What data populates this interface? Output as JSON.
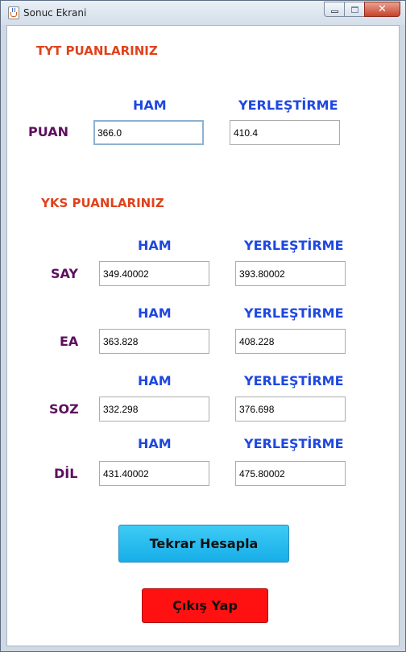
{
  "window": {
    "title": "Sonuc Ekrani",
    "close_glyph": "✕"
  },
  "tyt": {
    "title": "TYT PUANLARINIZ",
    "ham_header": "HAM",
    "yerlestirme_header": "YERLEŞTİRME",
    "row_label": "PUAN",
    "ham_value": "366.0",
    "yerlestirme_value": "410.4"
  },
  "yks": {
    "title": "YKS PUANLARINIZ",
    "rows": [
      {
        "label": "SAY",
        "ham_header": "HAM",
        "yerlestirme_header": "YERLEŞTİRME",
        "ham_value": "349.40002",
        "yerlestirme_value": "393.80002"
      },
      {
        "label": "EA",
        "ham_header": "HAM",
        "yerlestirme_header": "YERLEŞTİRME",
        "ham_value": "363.828",
        "yerlestirme_value": "408.228"
      },
      {
        "label": "SOZ",
        "ham_header": "HAM",
        "yerlestirme_header": "YERLEŞTİRME",
        "ham_value": "332.298",
        "yerlestirme_value": "376.698"
      },
      {
        "label": "DİL",
        "ham_header": "HAM",
        "yerlestirme_header": "YERLEŞTİRME",
        "ham_value": "431.40002",
        "yerlestirme_value": "475.80002"
      }
    ]
  },
  "buttons": {
    "recalculate": "Tekrar Hesapla",
    "exit": "Çıkış Yap"
  },
  "colors": {
    "section_title": "#e0421c",
    "column_header": "#1f48e0",
    "row_label": "#5e0f5e",
    "recalculate_button": "#17aee8",
    "exit_button": "#ff1111"
  }
}
